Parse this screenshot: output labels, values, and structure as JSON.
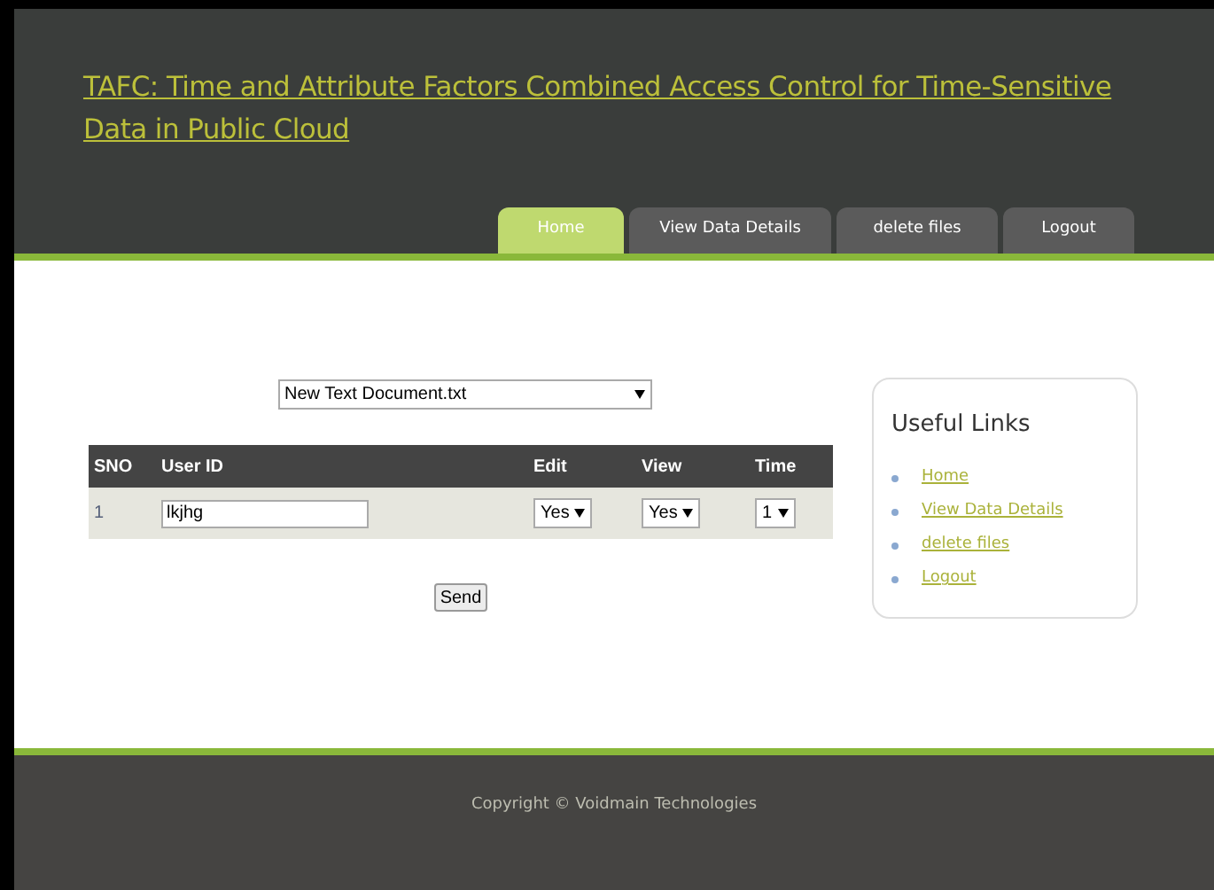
{
  "header": {
    "title": "TAFC: Time and Attribute Factors Combined Access Control for Time-Sensitive Data in Public Cloud"
  },
  "tabs": [
    {
      "label": "Home",
      "selected": true
    },
    {
      "label": "View Data Details",
      "selected": false
    },
    {
      "label": "delete files",
      "selected": false
    },
    {
      "label": "Logout",
      "selected": false
    }
  ],
  "file_select": {
    "value": "New Text Document.txt"
  },
  "table": {
    "columns": [
      "SNO",
      "User ID",
      "Edit",
      "View",
      "Time"
    ],
    "rows": [
      {
        "sno": "1",
        "user_id": "lkjhg",
        "edit": "Yes",
        "view": "Yes",
        "time": "1"
      }
    ]
  },
  "send_button": "Send",
  "useful_links": {
    "title": "Useful Links",
    "items": [
      "Home",
      "View Data Details",
      "delete files",
      "Logout"
    ]
  },
  "footer": "Copyright © Voidmain Technologies"
}
